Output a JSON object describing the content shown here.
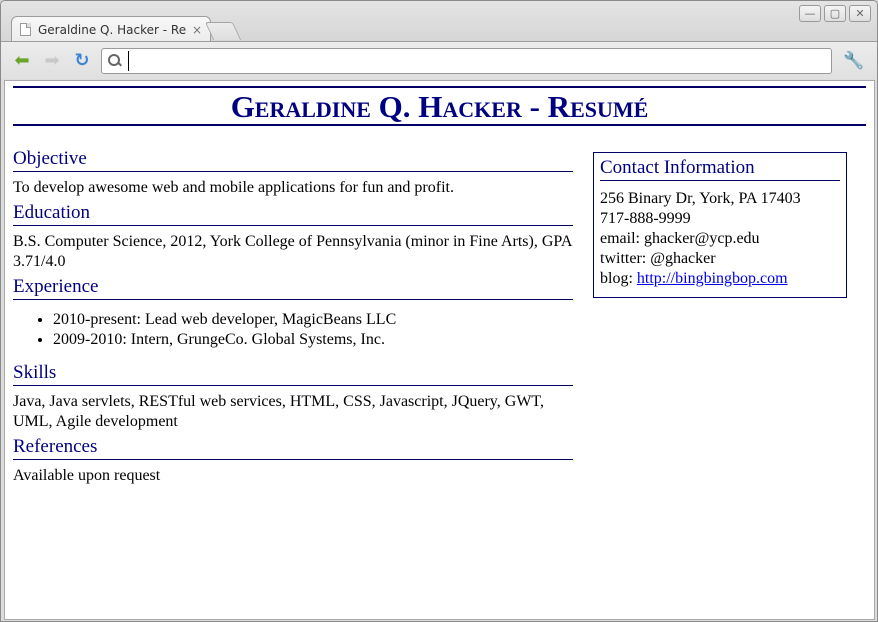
{
  "browser": {
    "tab_title": "Geraldine Q. Hacker - Resumé",
    "tab_close": "×",
    "address_value": "",
    "win_min": "—",
    "win_max": "▢",
    "win_close": "✕",
    "icons": {
      "back": "back-arrow-icon",
      "forward": "forward-arrow-icon",
      "reload": "reload-icon",
      "search": "search-icon",
      "wrench": "wrench-icon"
    }
  },
  "resume": {
    "title": "Geraldine Q. Hacker - Resumé",
    "objective": {
      "heading": "Objective",
      "text": "To develop awesome web and mobile applications for fun and profit."
    },
    "education": {
      "heading": "Education",
      "text": "B.S. Computer Science, 2012, York College of Pennsylvania (minor in Fine Arts), GPA 3.71/4.0"
    },
    "experience": {
      "heading": "Experience",
      "items": [
        "2010-present: Lead web developer, MagicBeans LLC",
        "2009-2010: Intern, GrungeCo. Global Systems, Inc."
      ]
    },
    "skills": {
      "heading": "Skills",
      "text": "Java, Java servlets, RESTful web services, HTML, CSS, Javascript, JQuery, GWT, UML, Agile development"
    },
    "references": {
      "heading": "References",
      "text": "Available upon request"
    },
    "contact": {
      "heading": "Contact Information",
      "address": "256 Binary Dr, York, PA 17403",
      "phone": "717-888-9999",
      "email": "email: ghacker@ycp.edu",
      "twitter": "twitter: @ghacker",
      "blog_label": "blog: ",
      "blog_link": "http://bingbingbop.com"
    }
  },
  "colors": {
    "heading": "#000080",
    "rule": "#000066",
    "link": "#0000ee"
  }
}
